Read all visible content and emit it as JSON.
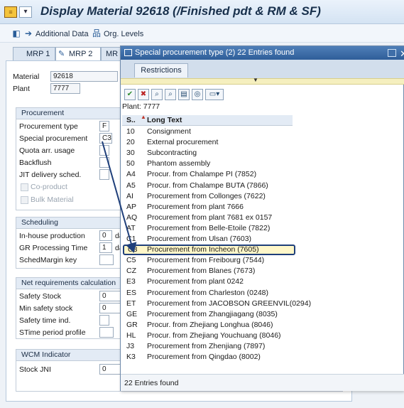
{
  "window": {
    "title": "Display Material 92618 (/Finished pdt & RM & SF)"
  },
  "toolbar": {
    "additional_data": "Additional Data",
    "org_levels": "Org. Levels"
  },
  "tabs": [
    {
      "label": "MRP 1"
    },
    {
      "label": "MRP 2"
    },
    {
      "label": "MR"
    }
  ],
  "header": {
    "material_label": "Material",
    "material_value": "92618",
    "plant_label": "Plant",
    "plant_value": "7777"
  },
  "procurement": {
    "title": "Procurement",
    "type_label": "Procurement type",
    "type_value": "F",
    "special_label": "Special procurement",
    "special_value": "C3",
    "quota_label": "Quota arr. usage",
    "backflush_label": "Backflush",
    "jit_label": "JIT delivery sched.",
    "coproduct_label": "Co-product",
    "bulk_label": "Bulk Material"
  },
  "scheduling": {
    "title": "Scheduling",
    "inhouse_label": "In-house production",
    "inhouse_value": "0",
    "inhouse_unit": "da",
    "gr_label": "GR Processing Time",
    "gr_value": "1",
    "gr_unit": "da",
    "margin_label": "SchedMargin key"
  },
  "net_req": {
    "title": "Net requirements calculation",
    "safety_label": "Safety Stock",
    "safety_value": "0",
    "min_safety_label": "Min safety stock",
    "min_safety_value": "0",
    "safety_time_label": "Safety time ind.",
    "stime_label": "STime period profile"
  },
  "wcm": {
    "title": "WCM Indicator",
    "stock_label": "Stock JNI",
    "stock_value": "0"
  },
  "popup": {
    "title": "Special procurement type (2)   22 Entries found",
    "tab_label": "Restrictions",
    "plant_line": "Plant: 7777",
    "col_code": "S..",
    "col_text": "Long Text",
    "status": "22 Entries found",
    "rows": [
      {
        "code": "10",
        "text": "Consignment"
      },
      {
        "code": "20",
        "text": "External procurement"
      },
      {
        "code": "30",
        "text": "Subcontracting"
      },
      {
        "code": "50",
        "text": "Phantom assembly"
      },
      {
        "code": "A4",
        "text": "Procur. from Chalampe PI (7852)"
      },
      {
        "code": "A5",
        "text": "Procur. from Chalampe BUTA (7866)"
      },
      {
        "code": "AI",
        "text": "Procurement from Collonges (7622)"
      },
      {
        "code": "AP",
        "text": "Procurement from plant 7666"
      },
      {
        "code": "AQ",
        "text": "Procurement from plant  7681 ex 0157"
      },
      {
        "code": "AT",
        "text": "Procurement from Belle-Etoile (7822)"
      },
      {
        "code": "C1",
        "text": "Procurement from Ulsan (7603)"
      },
      {
        "code": "C3",
        "text": "Procurement from Incheon (7605)"
      },
      {
        "code": "C5",
        "text": "Procurement from Freibourg (7544)"
      },
      {
        "code": "CZ",
        "text": "Procurement from Blanes (7673)"
      },
      {
        "code": "E3",
        "text": "Procurement from plant 0242"
      },
      {
        "code": "ES",
        "text": "Procurement from Charleston (0248)"
      },
      {
        "code": "ET",
        "text": "Procurement from JACOBSON GREENVIL(0294)"
      },
      {
        "code": "GE",
        "text": "Procurement from Zhangjiagang (8035)"
      },
      {
        "code": "GR",
        "text": "Procur. from Zhejiang Longhua (8046)"
      },
      {
        "code": "HL",
        "text": "Procur. from Zhejiang Youchuang (8046)"
      },
      {
        "code": "J3",
        "text": "Procurement from Zhenjiang (7897)"
      },
      {
        "code": "K3",
        "text": "Procurement from Qingdao (8002)"
      }
    ]
  },
  "colors": {
    "selection_border": "#1f3f7a",
    "selection_fill": "#fff7c9",
    "popup_title": "#2f5e99",
    "annotation_arrow": "#1f3f7a"
  }
}
